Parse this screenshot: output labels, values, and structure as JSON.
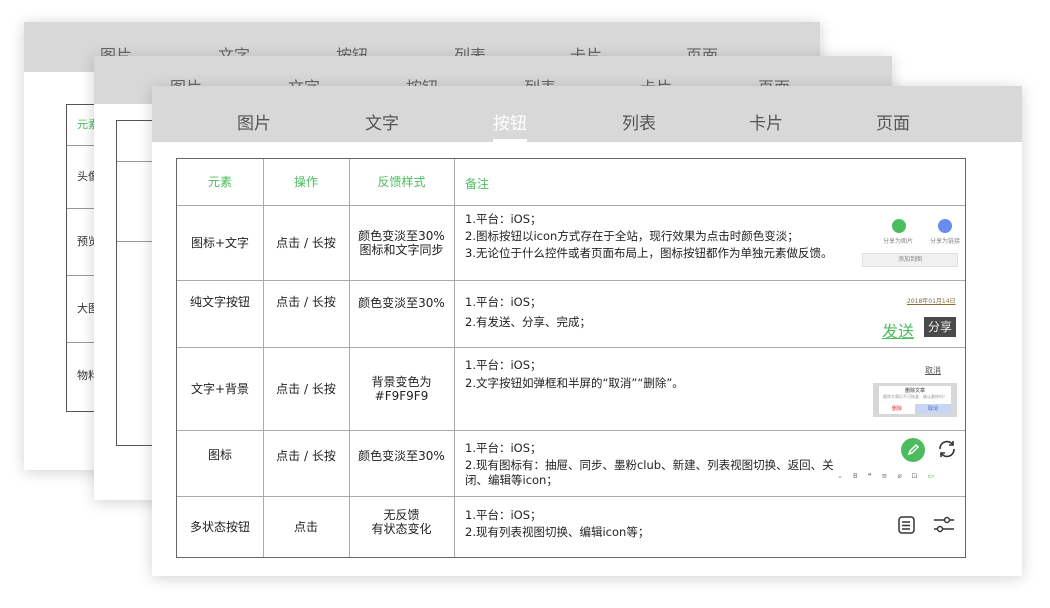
{
  "tabs": [
    "图片",
    "文字",
    "按钮",
    "列表",
    "卡片",
    "页面"
  ],
  "active_tab": "按钮",
  "back_card": {
    "header": "元素",
    "rows": [
      "头像",
      "预览",
      "大图",
      "物料"
    ]
  },
  "table": {
    "headers": [
      "元素",
      "操作",
      "反馈样式",
      "备注"
    ],
    "rows": [
      {
        "element": "图标+文字",
        "action": "点击 / 长按",
        "feedback": [
          "颜色变淡至30%",
          "图标和文字同步"
        ],
        "notes": [
          "1.平台：iOS；",
          "2.图标按钮以icon方式存在于全站，现行效果为点击时颜色变淡；",
          "3.无论位于什么控件或者页面布局上，图标按钮都作为单独元素做反馈。"
        ]
      },
      {
        "element": "纯文字按钮",
        "action": "点击 / 长按",
        "feedback": [
          "颜色变淡至30%"
        ],
        "notes": [
          "1.平台：iOS；",
          "2.有发送、分享、完成；"
        ]
      },
      {
        "element": "文字+背景",
        "action": "点击 / 长按",
        "feedback": [
          "背景变色为#F9F9F9"
        ],
        "notes": [
          "1.平台：iOS；",
          "2.文字按钮如弹框和半屏的“取消”“删除”。"
        ]
      },
      {
        "element": "图标",
        "action": "点击 / 长按",
        "feedback": [
          "颜色变淡至30%"
        ],
        "notes": [
          "1.平台：iOS；",
          "2.现有图标有：抽屉、同步、墨粉club、新建、列表视图切换、返回、关",
          "闭、编辑等icon；"
        ]
      },
      {
        "element": "多状态按钮",
        "action": "点击",
        "feedback": [
          "无反馈",
          "有状态变化"
        ],
        "notes": [
          "1.平台：iOS；",
          "2.现有列表视图切换、编辑icon等；"
        ]
      }
    ]
  },
  "previews": {
    "share_labels": [
      "分享为图片",
      "分享为链接"
    ],
    "add_label": "添加到图",
    "date_text": "2018年01月14日",
    "send_label": "发送",
    "share_label": "分享",
    "cancel_label": "取消",
    "dialog_title": "删除文章",
    "dialog_desc": "删除文章后不可恢复，确认删除吗？",
    "dialog_delete": "删除",
    "dialog_cancel": "取消",
    "toolbar_glyphs": [
      "⌄",
      "B",
      "❝",
      "≡",
      "⌀",
      "⊡",
      "▭"
    ]
  },
  "colors": {
    "accent_green": "#4cbd5e",
    "tabbar_bg": "#d8d8d8",
    "link_blue": "#6a8cf0"
  }
}
